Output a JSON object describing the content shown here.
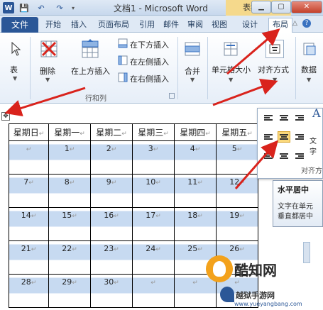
{
  "window": {
    "app_icon": "W",
    "title": "文档1 - Microsoft Word",
    "context_title": "表格工具",
    "minimize": "▁",
    "maximize": "▢",
    "close": "✕"
  },
  "tabs": {
    "file": "文件",
    "items": [
      "开始",
      "插入",
      "页面布局",
      "引用",
      "邮件",
      "审阅",
      "视图",
      "设计",
      "布局"
    ],
    "active": "布局"
  },
  "ribbon": {
    "table_label": "表",
    "delete_label": "删除",
    "insert_above_label": "在上方插入",
    "insert_below_label": "在下方插入",
    "insert_left_label": "在左侧插入",
    "insert_right_label": "在右侧插入",
    "group_rows_cols": "行和列",
    "merge_label": "合并",
    "cell_size_label": "单元格大小",
    "alignment_label": "对齐方式",
    "data_label": "数据"
  },
  "table": {
    "headers": [
      "星期日",
      "星期一",
      "星期二",
      "星期三",
      "星期四",
      "星期五"
    ],
    "rows": [
      [
        "",
        "1",
        "2",
        "3",
        "4",
        "5"
      ],
      [
        "7",
        "8",
        "9",
        "10",
        "11",
        "12"
      ],
      [
        "14",
        "15",
        "16",
        "17",
        "18",
        "19"
      ],
      [
        "21",
        "22",
        "23",
        "24",
        "25",
        "26"
      ],
      [
        "28",
        "29",
        "30",
        "",
        "",
        ""
      ]
    ],
    "cell_mark": "↵",
    "move_handle": "✥"
  },
  "align_popup": {
    "text_direction_glyph": "A",
    "text_direction_label": "文字",
    "footer": "对齐方",
    "selected": "水平居中"
  },
  "tooltip": {
    "title": "水平居中",
    "line1": "文字在单元",
    "line2": "垂直都居中"
  },
  "watermark": {
    "brand": "酷知网",
    "site": "越狱手游网",
    "url": "www.yueyangbang.com"
  },
  "colors": {
    "file_tab": "#2b5797",
    "row_highlight": "#c7daf1",
    "arrow": "#d9231c",
    "selected_align": "#fbd97c"
  }
}
